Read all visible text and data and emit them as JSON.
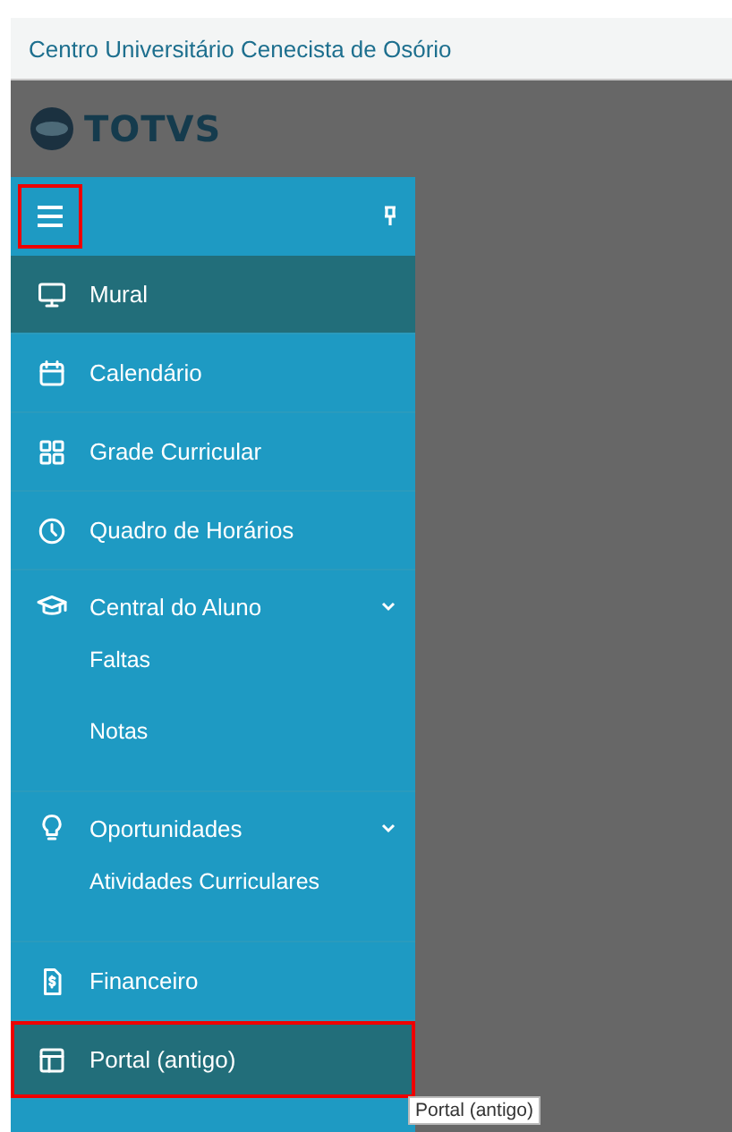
{
  "header": {
    "title": "Centro Universitário Cenecista de Osório"
  },
  "logo": {
    "text": "TOTVS"
  },
  "menu_button": {
    "annotated": true
  },
  "sidebar": {
    "items": [
      {
        "label": "Mural",
        "selected": true,
        "annotated": false
      },
      {
        "label": "Calendário",
        "selected": false,
        "annotated": false
      },
      {
        "label": "Grade Curricular",
        "selected": false,
        "annotated": false
      },
      {
        "label": "Quadro de Horários",
        "selected": false,
        "annotated": false
      },
      {
        "label": "Central do Aluno",
        "selected": false,
        "annotated": false,
        "expanded": true,
        "children": [
          {
            "label": "Faltas"
          },
          {
            "label": "Notas"
          }
        ]
      },
      {
        "label": "Oportunidades",
        "selected": false,
        "annotated": false,
        "expanded": true,
        "children": [
          {
            "label": "Atividades Curriculares"
          }
        ]
      },
      {
        "label": "Financeiro",
        "selected": false,
        "annotated": false
      },
      {
        "label": "Portal (antigo)",
        "selected": true,
        "annotated": true
      }
    ]
  },
  "tooltip": {
    "text": "Portal (antigo)"
  }
}
